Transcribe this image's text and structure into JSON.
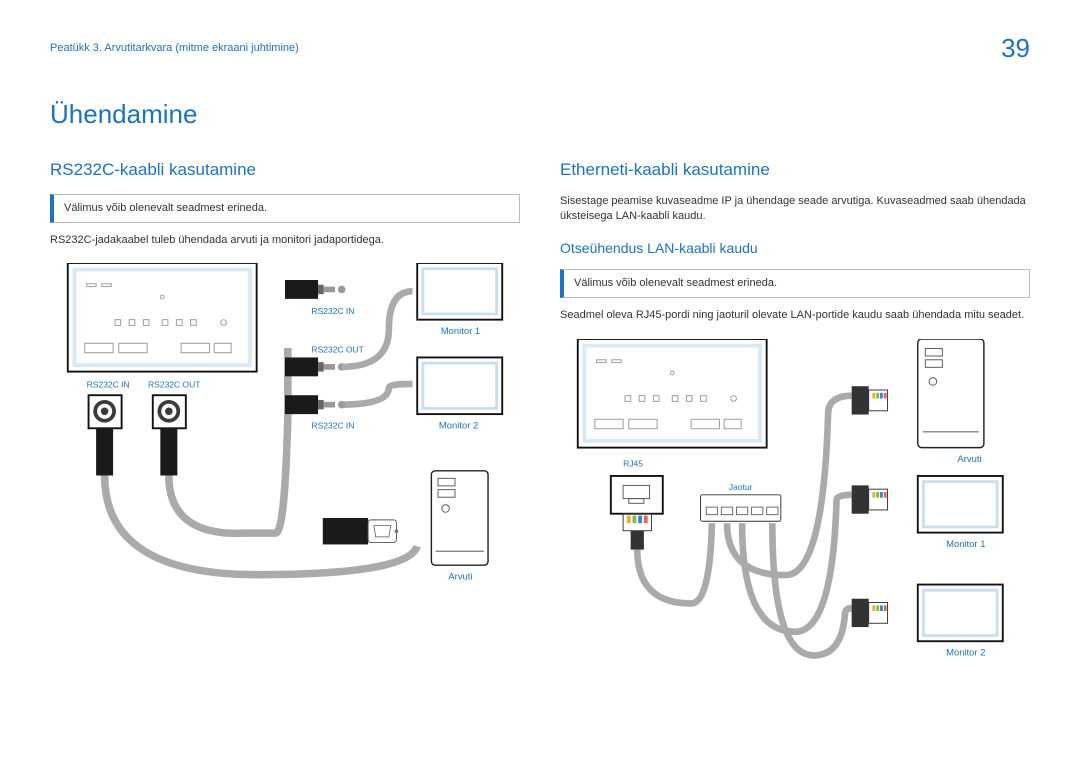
{
  "header": {
    "chapter": "Peatükk 3. Arvutitarkvara (mitme ekraani juhtimine)",
    "page": "39"
  },
  "title": "Ühendamine",
  "left": {
    "heading": "RS232C-kaabli kasutamine",
    "note": "Välimus võib olenevalt seadmest erineda.",
    "text": "RS232C-jadakaabel tuleb ühendada arvuti ja monitori jadaportidega.",
    "labels": {
      "rs232c_in": "RS232C IN",
      "rs232c_out": "RS232C OUT",
      "monitor1": "Monitor 1",
      "monitor2": "Monitor 2",
      "arvuti": "Arvuti"
    }
  },
  "right": {
    "heading": "Etherneti-kaabli kasutamine",
    "text": "Sisestage peamise kuvaseadme IP ja ühendage seade arvutiga. Kuvaseadmed saab ühendada üksteisega LAN-kaabli kaudu.",
    "subheading": "Otseühendus LAN-kaabli kaudu",
    "note": "Välimus võib olenevalt seadmest erineda.",
    "text2": "Seadmel oleva RJ45-pordi ning jaoturil olevate LAN-portide kaudu saab ühendada mitu seadet.",
    "labels": {
      "rj45": "RJ45",
      "jaotur": "Jaotur",
      "arvuti": "Arvuti",
      "monitor1": "Monitor 1",
      "monitor2": "Monitor 2"
    }
  }
}
